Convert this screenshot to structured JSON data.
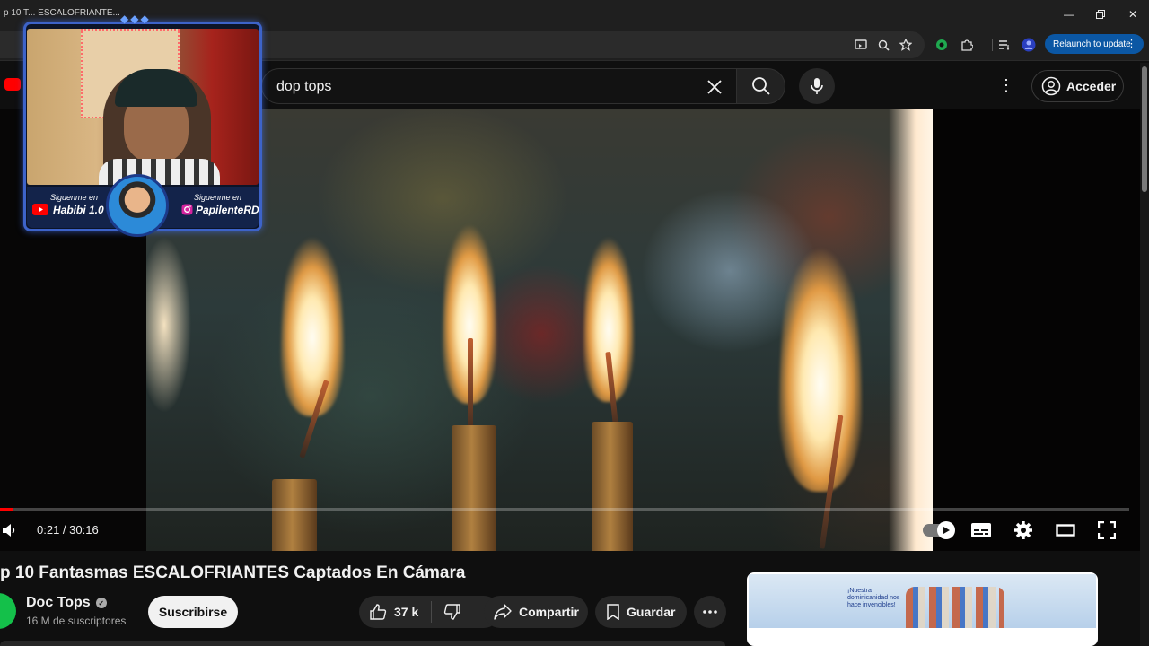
{
  "browser": {
    "tab_title": "p 10 T... ESCALOFRIANTE...",
    "relaunch_label": "Relaunch to update",
    "window_controls": [
      "minimize-icon",
      "restore-icon",
      "close-icon"
    ],
    "toolbar_icons": [
      "cast-icon",
      "zoom-icon",
      "bookmark-star-icon",
      "extension-green-icon",
      "puzzle-icon",
      "media-queue-icon",
      "profile-icon"
    ]
  },
  "youtube": {
    "search_query": "dop tops",
    "signin_label": "Acceder"
  },
  "player": {
    "time_current": "0:21",
    "time_separator": " / ",
    "time_total": "30:16",
    "progress": 0.0116,
    "autoplay_on": true
  },
  "overlay": {
    "left_label": "Siguenme en",
    "left_handle": "Habibi 1.0",
    "right_label": "Siguenme en",
    "right_handle": "PapilenteRD"
  },
  "video": {
    "title": "p 10 Fantasmas ESCALOFRIANTES Captados En Cámara",
    "channel_name": "Doc Tops",
    "subscribers": "16 M de suscriptores",
    "subscribe_label": "Suscribirse",
    "likes": "37 k",
    "share_label": "Compartir",
    "save_label": "Guardar"
  },
  "ad": {
    "text": "¡Nuestra dominicanidad nos hace invencibles!"
  },
  "colors": {
    "accent_blue": "#0b57a4",
    "progress_red": "#ff0000",
    "overlay_frame": "#3d63c9"
  }
}
